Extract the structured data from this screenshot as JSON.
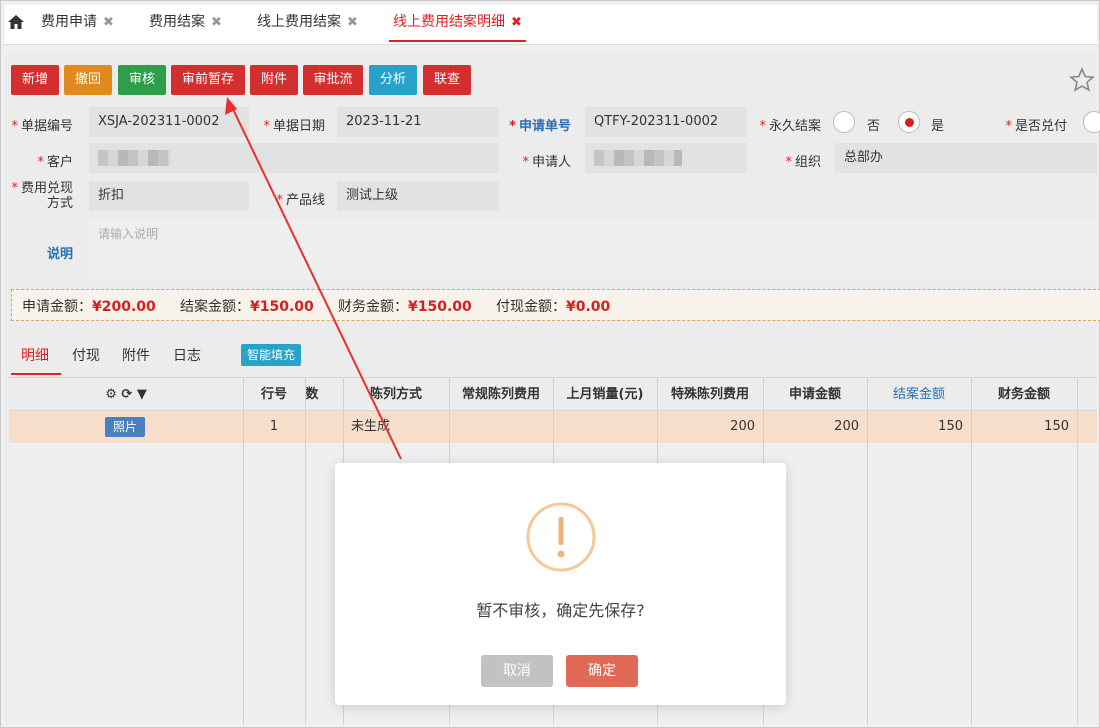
{
  "tabs": [
    {
      "label": "费用申请"
    },
    {
      "label": "费用结案"
    },
    {
      "label": "线上费用结案"
    },
    {
      "label": "线上费用结案明细"
    }
  ],
  "toolbar": {
    "new": "新增",
    "withdraw": "撤回",
    "review": "审核",
    "pre_save": "审前暂存",
    "attach": "附件",
    "approval": "审批流",
    "analyze": "分析",
    "linked": "联查"
  },
  "form": {
    "doc_no_label": "单据编号",
    "doc_no": "XSJA-202311-0002",
    "doc_date_label": "单据日期",
    "doc_date": "2023-11-21",
    "apply_no_label": "申请单号",
    "apply_no": "QTFY-202311-0002",
    "permanent_label": "永久结案",
    "opt_no": "否",
    "opt_yes": "是",
    "cash_label": "是否兑付",
    "customer_label": "客户",
    "applicant_label": "申请人",
    "org_label": "组织",
    "org": "总部办",
    "method_label_1": "费用兑现",
    "method_label_2": "方式",
    "method": "折扣",
    "product_label": "产品线",
    "product": "测试上级",
    "desc_label": "说明",
    "desc_placeholder": "请输入说明"
  },
  "amounts": {
    "apply_label": "申请金额：",
    "apply": "¥200.00",
    "close_label": "结案金额：",
    "close": "¥150.00",
    "finance_label": "财务金额：",
    "finance": "¥150.00",
    "cash_label": "付现金额：",
    "cash": "¥0.00"
  },
  "subtabs": {
    "detail": "明细",
    "cash": "付现",
    "attach": "附件",
    "log": "日志",
    "smart_fill": "智能填充"
  },
  "grid": {
    "headers": {
      "row_no": "行号",
      "num": "数",
      "display_method": "陈列方式",
      "regular_fee": "常规陈列费用",
      "last_sales": "上月销量(元)",
      "special_fee": "特殊陈列费用",
      "apply_amount": "申请金额",
      "close_amount": "结案金额",
      "finance_amount": "财务金额"
    },
    "row": {
      "photo": "照片",
      "row_no": "1",
      "display_method": "未生成",
      "special_fee": "200",
      "apply_amount": "200",
      "close_amount": "150",
      "finance_amount": "150"
    }
  },
  "dialog": {
    "message": "暂不审核，确定先保存?",
    "cancel": "取消",
    "confirm": "确定"
  },
  "colors": {
    "red": "#d42f2f",
    "orange": "#e08a1e",
    "green": "#2e9e4a",
    "teal": "#27a2c8",
    "confirm": "#e06a55",
    "cancel": "#c2c2c2"
  }
}
